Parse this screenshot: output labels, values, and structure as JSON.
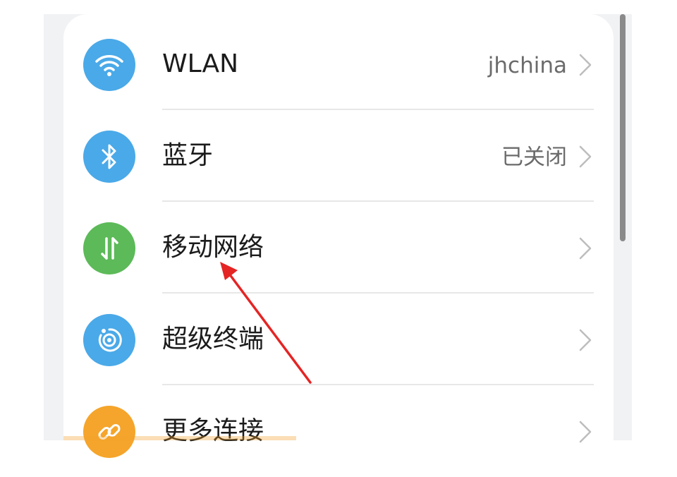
{
  "settings_list": {
    "items": [
      {
        "id": "wlan",
        "label": "WLAN",
        "value": "jhchina",
        "icon": "wifi-icon",
        "icon_color": "#4aa9e8"
      },
      {
        "id": "bluetooth",
        "label": "蓝牙",
        "value": "已关闭",
        "icon": "bluetooth-icon",
        "icon_color": "#4aa9e8"
      },
      {
        "id": "mobile-network",
        "label": "移动网络",
        "value": "",
        "icon": "mobile-data-icon",
        "icon_color": "#5cba58"
      },
      {
        "id": "super-device",
        "label": "超级终端",
        "value": "",
        "icon": "super-device-icon",
        "icon_color": "#4aa9e8"
      },
      {
        "id": "more-connections",
        "label": "更多连接",
        "value": "",
        "icon": "link-icon",
        "icon_color": "#f5a52b"
      }
    ]
  },
  "annotation": {
    "arrow_color": "#e52424",
    "points_to": "mobile-network"
  }
}
